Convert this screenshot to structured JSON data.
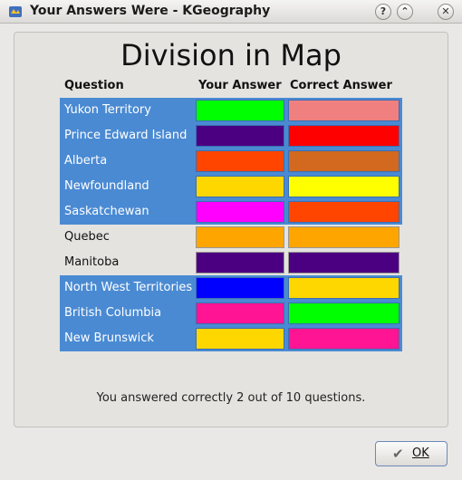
{
  "window": {
    "title": "Your Answers Were - KGeography",
    "help_button": "?",
    "shade_button": "⌃",
    "close_button": "✕"
  },
  "title": "Division in Map",
  "headers": {
    "question": "Question",
    "your_answer": "Your Answer",
    "correct_answer": "Correct Answer"
  },
  "rows": [
    {
      "question": "Yukon Territory",
      "correct": false,
      "your_color": "#00ff00",
      "correct_color": "#f08080"
    },
    {
      "question": "Prince Edward Island",
      "correct": false,
      "your_color": "#4b0082",
      "correct_color": "#ff0000"
    },
    {
      "question": "Alberta",
      "correct": false,
      "your_color": "#ff4500",
      "correct_color": "#d2691e"
    },
    {
      "question": "Newfoundland",
      "correct": false,
      "your_color": "#ffd700",
      "correct_color": "#ffff00"
    },
    {
      "question": "Saskatchewan",
      "correct": false,
      "your_color": "#ff00ff",
      "correct_color": "#ff4500"
    },
    {
      "question": "Quebec",
      "correct": true,
      "your_color": "#ffa500",
      "correct_color": "#ffa500"
    },
    {
      "question": "Manitoba",
      "correct": true,
      "your_color": "#4b0082",
      "correct_color": "#4b0082"
    },
    {
      "question": "North West Territories",
      "correct": false,
      "your_color": "#0000ff",
      "correct_color": "#ffd700"
    },
    {
      "question": "British Columbia",
      "correct": false,
      "your_color": "#ff1493",
      "correct_color": "#00ff00"
    },
    {
      "question": "New Brunswick",
      "correct": false,
      "your_color": "#ffd700",
      "correct_color": "#ff1493"
    }
  ],
  "summary": "You answered correctly 2 out of 10 questions.",
  "ok_button": {
    "label": "OK",
    "icon": "check-icon"
  }
}
